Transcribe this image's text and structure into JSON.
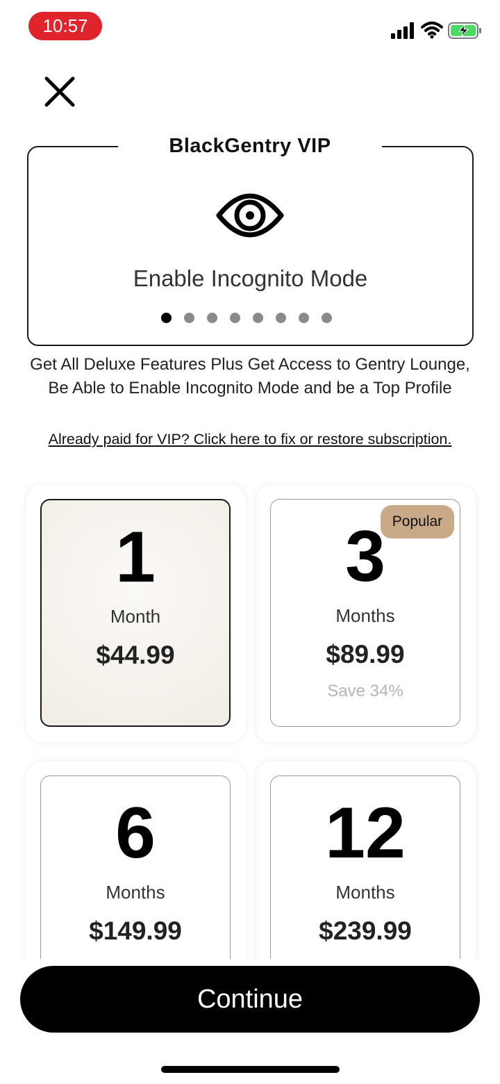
{
  "status_bar": {
    "time": "10:57",
    "accent_color": "#e0242b"
  },
  "icons": {
    "close": "close-icon",
    "feature": "eye-icon",
    "signal": "signal-icon",
    "wifi": "wifi-icon",
    "battery": "battery-charging-icon"
  },
  "feature": {
    "title": "BlackGentry VIP",
    "label": "Enable Incognito Mode",
    "carousel_dots": 8,
    "active_dot": 1
  },
  "description": "Get All Deluxe Features Plus Get Access to Gentry Lounge, Be Able to Enable Incognito Mode and be a Top Profile",
  "restore_link": "Already paid for VIP? Click here to fix or restore subscription.",
  "plans": [
    {
      "number": "1",
      "unit": "Month",
      "price": "$44.99",
      "save": "",
      "badge": "",
      "selected": true
    },
    {
      "number": "3",
      "unit": "Months",
      "price": "$89.99",
      "save": "Save 34%",
      "badge": "Popular",
      "selected": false
    },
    {
      "number": "6",
      "unit": "Months",
      "price": "$149.99",
      "save": "",
      "badge": "",
      "selected": false
    },
    {
      "number": "12",
      "unit": "Months",
      "price": "$239.99",
      "save": "",
      "badge": "",
      "selected": false
    }
  ],
  "badge_color": "#c9a987",
  "continue_label": "Continue"
}
